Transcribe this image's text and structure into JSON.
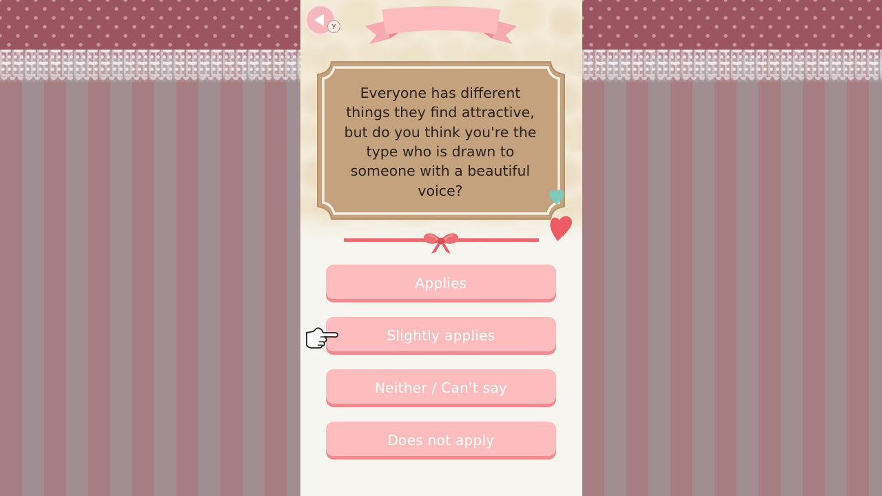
{
  "question": {
    "text": "Everyone has different\nthings they find attractive,\nbut do you think you're the\ntype who is drawn to\nsomeone with a beautiful\nvoice?"
  },
  "controls": {
    "back_button_hint": "Y"
  },
  "answers": [
    {
      "label": "Applies"
    },
    {
      "label": "Slightly applies",
      "highlighted": true
    },
    {
      "label": "Neither / Can't say"
    },
    {
      "label": "Does not apply"
    }
  ],
  "colors": {
    "button_fill": "#fdbcbd",
    "button_shadow": "#f28b8f",
    "card_fill": "#c4a27d",
    "accent_red": "#e86a70",
    "mint": "#7fc9b8"
  },
  "icons": {
    "back": "back-arrow-icon",
    "cursor": "pointing-hand-icon",
    "bow": "ribbon-bow-icon",
    "hearts": [
      "mint-heart-icon",
      "red-heart-icon"
    ]
  }
}
